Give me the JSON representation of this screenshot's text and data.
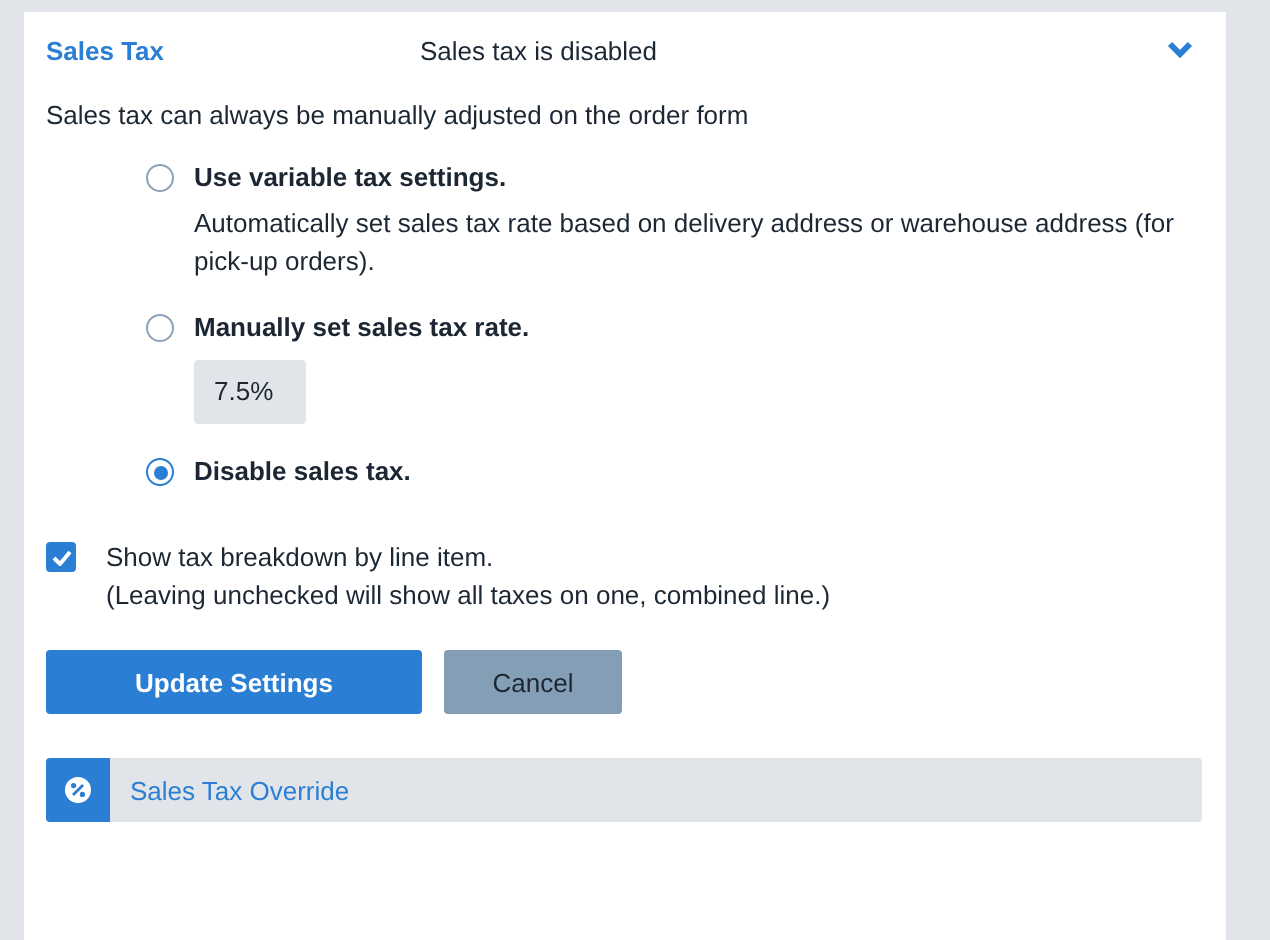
{
  "section": {
    "title": "Sales Tax",
    "status": "Sales tax is disabled",
    "expanded": true
  },
  "note": "Sales tax can always be manually adjusted on the order form",
  "options": [
    {
      "label": "Use variable tax settings.",
      "description": "Automatically set sales tax rate based on delivery address or warehouse address (for pick-up orders).",
      "selected": false
    },
    {
      "label": "Manually set sales tax rate.",
      "rate": "7.5%",
      "selected": false
    },
    {
      "label": "Disable sales tax.",
      "selected": true
    }
  ],
  "breakdown": {
    "checked": true,
    "label": "Show tax breakdown by line item.",
    "hint": "(Leaving unchecked will show all taxes on one, combined line.)"
  },
  "buttons": [
    {
      "label": "Update Settings",
      "kind": "primary"
    },
    {
      "label": "Cancel",
      "kind": "secondary"
    }
  ],
  "override": {
    "label": "Sales Tax Override"
  }
}
